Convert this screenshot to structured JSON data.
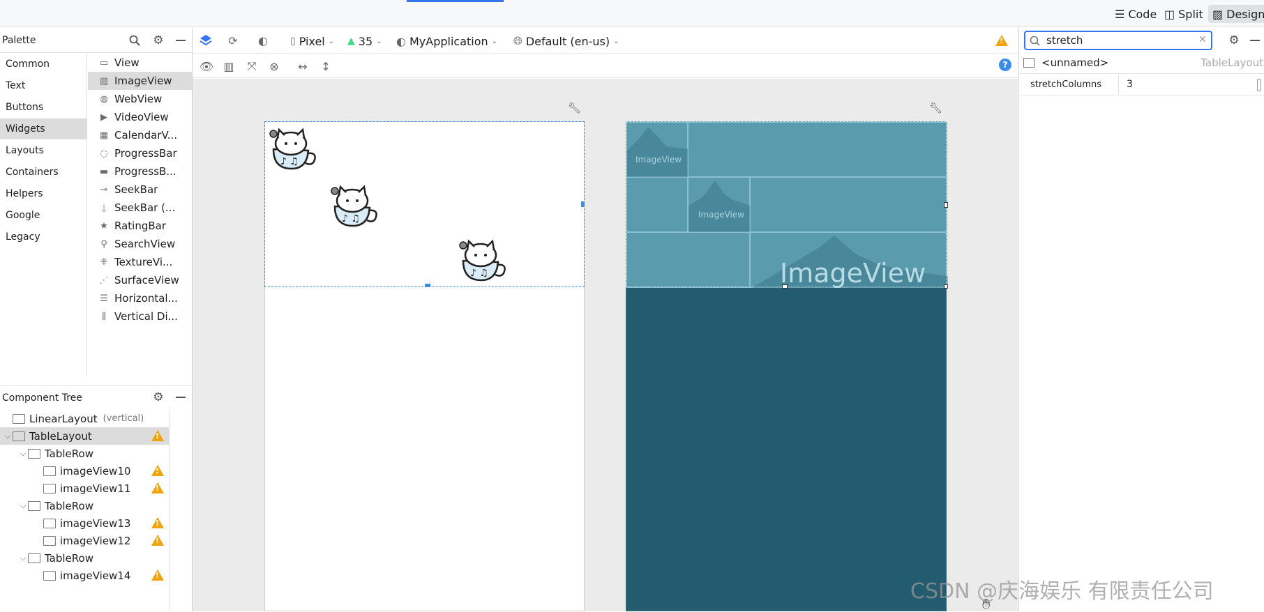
{
  "view_modes": {
    "code": "Code",
    "split": "Split",
    "design": "Design"
  },
  "palette": {
    "title": "Palette",
    "categories": [
      "Common",
      "Text",
      "Buttons",
      "Widgets",
      "Layouts",
      "Containers",
      "Helpers",
      "Google",
      "Legacy"
    ],
    "selected_category": "Widgets",
    "widgets": [
      {
        "label": "View",
        "icon": "view-icon"
      },
      {
        "label": "ImageView",
        "icon": "image-icon"
      },
      {
        "label": "WebView",
        "icon": "globe-icon"
      },
      {
        "label": "VideoView",
        "icon": "video-icon"
      },
      {
        "label": "CalendarV...",
        "icon": "calendar-icon"
      },
      {
        "label": "ProgressBar",
        "icon": "spinner-icon"
      },
      {
        "label": "ProgressB...",
        "icon": "progress-bar-icon"
      },
      {
        "label": "SeekBar",
        "icon": "seekbar-icon"
      },
      {
        "label": "SeekBar (...",
        "icon": "seekbar-discrete-icon"
      },
      {
        "label": "RatingBar",
        "icon": "star-icon"
      },
      {
        "label": "SearchView",
        "icon": "search-icon"
      },
      {
        "label": "TextureVi...",
        "icon": "texture-icon"
      },
      {
        "label": "SurfaceView",
        "icon": "surface-icon"
      },
      {
        "label": "Horizontal...",
        "icon": "horizontal-divider-icon"
      },
      {
        "label": "Vertical Di...",
        "icon": "vertical-divider-icon"
      }
    ],
    "selected_widget": "ImageView"
  },
  "component_tree": {
    "title": "Component Tree",
    "items": [
      {
        "label": "LinearLayout",
        "suffix": "(vertical)",
        "depth": 0,
        "warn": false,
        "chevron": false,
        "icon": "linear-layout-icon"
      },
      {
        "label": "TableLayout",
        "suffix": "",
        "depth": 0,
        "warn": true,
        "chevron": true,
        "icon": "table-layout-icon"
      },
      {
        "label": "TableRow",
        "suffix": "",
        "depth": 1,
        "warn": false,
        "chevron": true,
        "icon": "table-row-icon"
      },
      {
        "label": "imageView10",
        "suffix": "",
        "depth": 2,
        "warn": true,
        "chevron": false,
        "icon": "image-icon"
      },
      {
        "label": "imageView11",
        "suffix": "",
        "depth": 2,
        "warn": true,
        "chevron": false,
        "icon": "image-icon"
      },
      {
        "label": "TableRow",
        "suffix": "",
        "depth": 1,
        "warn": false,
        "chevron": true,
        "icon": "table-row-icon"
      },
      {
        "label": "imageView13",
        "suffix": "",
        "depth": 2,
        "warn": true,
        "chevron": false,
        "icon": "image-icon"
      },
      {
        "label": "imageView12",
        "suffix": "",
        "depth": 2,
        "warn": true,
        "chevron": false,
        "icon": "image-icon"
      },
      {
        "label": "TableRow",
        "suffix": "",
        "depth": 1,
        "warn": false,
        "chevron": true,
        "icon": "table-row-icon"
      },
      {
        "label": "imageView14",
        "suffix": "",
        "depth": 2,
        "warn": true,
        "chevron": false,
        "icon": "image-icon"
      }
    ],
    "selected": "TableLayout"
  },
  "toolbar": {
    "device": "Pixel",
    "api": "35",
    "theme": "MyApplication",
    "locale": "Default (en-us)"
  },
  "blueprint": {
    "small_label_1": "ImageView",
    "small_label_2": "ImageView",
    "big_label": "ImageView"
  },
  "attributes": {
    "search_value": "stretch",
    "component_name": "<unnamed>",
    "component_type": "TableLayout",
    "rows": [
      {
        "name": "stretchColumns",
        "value": "3"
      }
    ]
  },
  "watermark": "CSDN @庆海娱乐 有限责任公司",
  "colors": {
    "accent": "#3574f0",
    "warning": "#f0a30a",
    "blueprint_bg": "#235c6e",
    "blueprint_table": "#5597ab"
  }
}
